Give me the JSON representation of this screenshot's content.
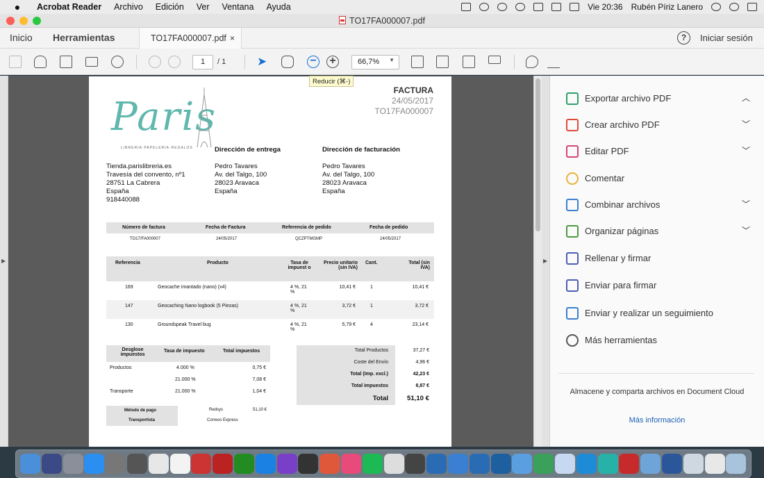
{
  "menubar": {
    "app": "Acrobat Reader",
    "items": [
      "Archivo",
      "Edición",
      "Ver",
      "Ventana",
      "Ayuda"
    ],
    "datetime": "Vie 20:36",
    "user": "Rubén Píriz Lanero"
  },
  "window": {
    "title": "TO17FA000007.pdf"
  },
  "tabs": {
    "home": "Inicio",
    "tools": "Herramientas",
    "document": "TO17FA000007.pdf",
    "close": "×",
    "help": "?",
    "login": "Iniciar sesión"
  },
  "toolbar": {
    "page_current": "1",
    "page_total": "/ 1",
    "zoom": "66,7%",
    "tooltip": "Reducir (⌘-)"
  },
  "invoice": {
    "brand": "Paris",
    "brand_sub": "LIBRERIA·PAPELERIA·REGALOS",
    "title": "FACTURA",
    "date": "24/05/2017",
    "number": "TO17FA000007",
    "delivery_label": "Dirección de entrega",
    "billing_label": "Dirección de facturación",
    "sender": [
      "Tienda.parislibreria.es",
      "Travesía del convento, nº1",
      "28751 La Cabrera",
      "España",
      "918440088"
    ],
    "delivery": [
      "Pedro Tavares",
      "Av. del Talgo, 100",
      "28023 Aravaca",
      "España"
    ],
    "billing": [
      "Pedro Tavares",
      "Av. del Talgo, 100",
      "28023 Aravaca",
      "España"
    ],
    "meta_headers": [
      "Número de factura",
      "Fecha de Factura",
      "Referencia de pedido",
      "Fecha de pedido"
    ],
    "meta_values": [
      "TO17/FA000007",
      "24/05/2017",
      "QCZPTMGMP",
      "24/05/2017"
    ],
    "items_headers": [
      "Referencia",
      "Producto",
      "Tasa de impuest o",
      "Precio unitario (sin IVA)",
      "Cant.",
      "Total (sin IVA)"
    ],
    "items": [
      {
        "ref": "169",
        "product": "Geocache imantado (nano) (x4)",
        "tax": "4 %, 21 %",
        "price": "10,41 €",
        "qty": "1",
        "total": "10,41 €"
      },
      {
        "ref": "147",
        "product": "Geocaching Nano logbook (5 Piezas)",
        "tax": "4 %, 21 %",
        "price": "3,72 €",
        "qty": "1",
        "total": "3,72 €"
      },
      {
        "ref": "130",
        "product": "Groundspeak Travel bug",
        "tax": "4 %, 21 %",
        "price": "5,79 €",
        "qty": "4",
        "total": "23,14 €"
      }
    ],
    "tax_headers": [
      "Desglose impuestos",
      "Tasa de impuesto",
      "Total impuestos"
    ],
    "tax_rows": [
      {
        "label": "Productos",
        "rate": "4.000 %",
        "total": "0,75 €"
      },
      {
        "label": "",
        "rate": "21.000 %",
        "total": "7,08 €"
      },
      {
        "label": "Transporte",
        "rate": "21.000 %",
        "total": "1,04 €"
      }
    ],
    "totals": [
      {
        "label": "Total Productos",
        "value": "37,27 €"
      },
      {
        "label": "Coste del Envío",
        "value": "4,96 €"
      },
      {
        "label": "Total (Imp. excl.)",
        "value": "42,23 €"
      },
      {
        "label": "Total impuestos",
        "value": "8,87 €"
      },
      {
        "label": "Total",
        "value": "51,10 €"
      }
    ],
    "payment_label": "Método de pago",
    "payment_value": "Redsys",
    "payment_amount": "51,10 €",
    "carrier_label": "Transportista",
    "carrier_value": "Correos Express"
  },
  "tools": [
    "Exportar archivo PDF",
    "Crear archivo PDF",
    "Editar PDF",
    "Comentar",
    "Combinar archivos",
    "Organizar páginas",
    "Rellenar y firmar",
    "Enviar para firmar",
    "Enviar y realizar un seguimiento",
    "Más herramientas"
  ],
  "tool_colors": [
    "#2ea06a",
    "#e0493b",
    "#d1457a",
    "#e8b43a",
    "#3a7fd1",
    "#4a9a3e",
    "#4f5db3",
    "#4f5db3",
    "#3a7fd1",
    "#555555"
  ],
  "cloud_text": "Almacene y comparta archivos en Document Cloud",
  "more_info": "Más información"
}
